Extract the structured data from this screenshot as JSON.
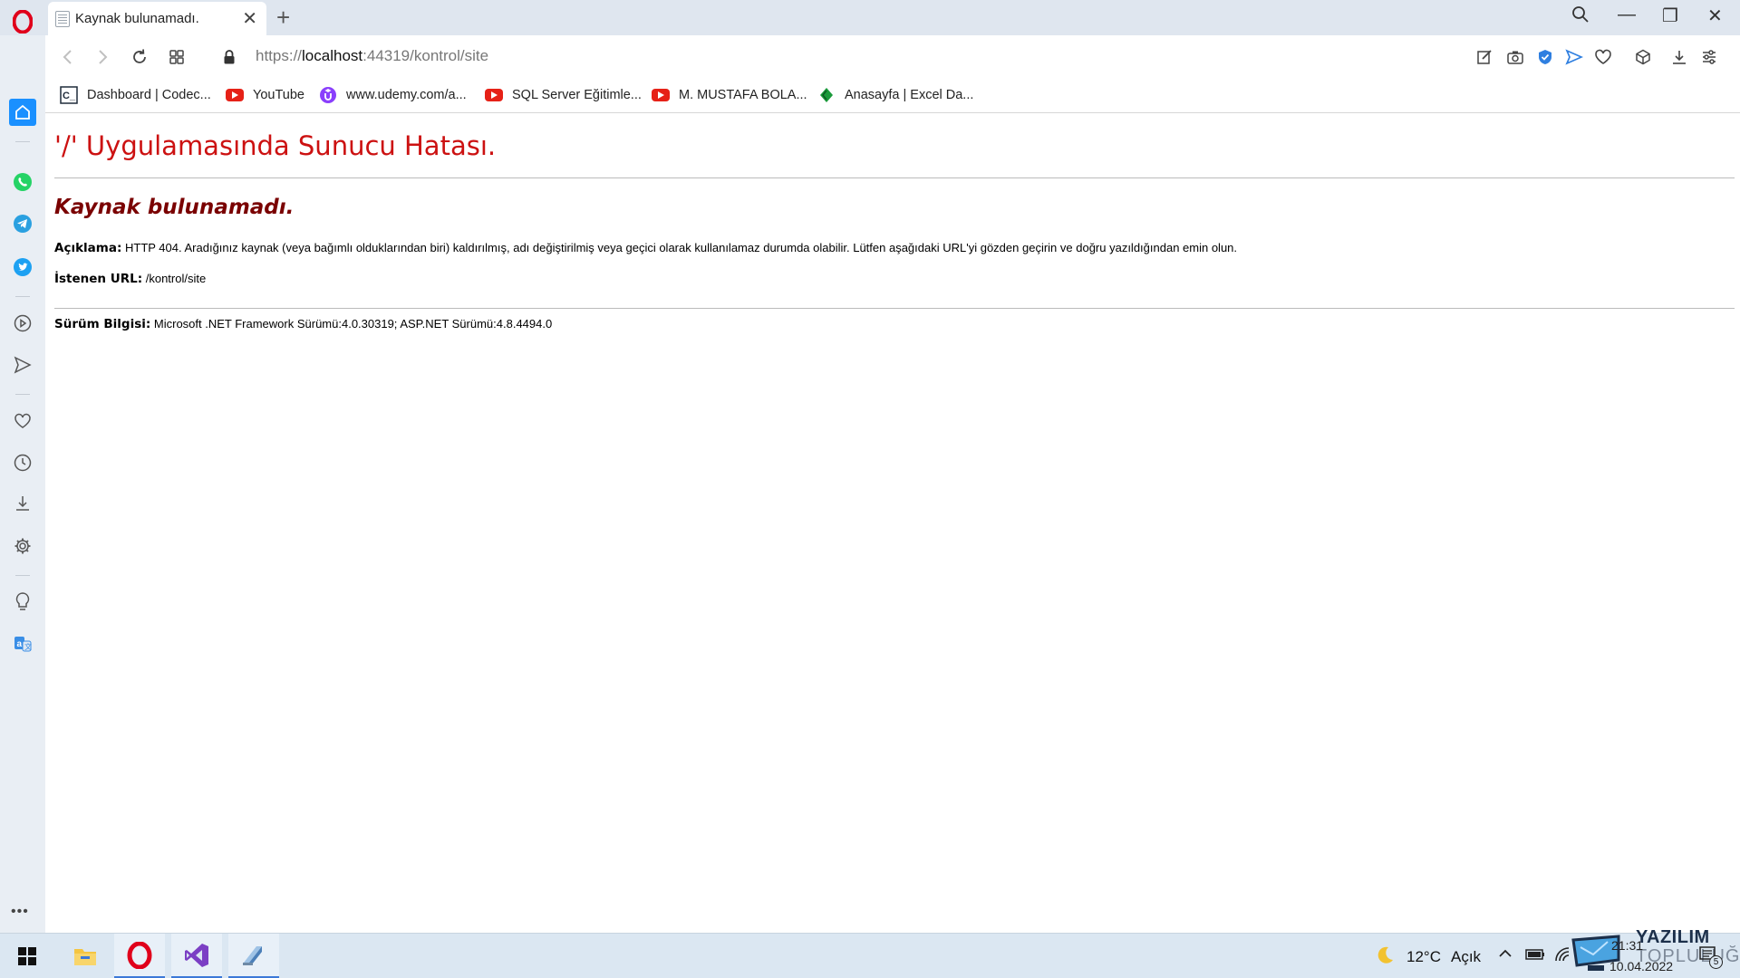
{
  "browser": {
    "tab": {
      "title": "Kaynak bulunamadı.",
      "close": "✕"
    },
    "new_tab": "+",
    "window": {
      "search": "search",
      "minimize": "—",
      "restore": "❐",
      "close": "✕"
    },
    "address": {
      "scheme": "https://",
      "host": "localhost",
      "rest": ":44319/kontrol/site"
    },
    "bookmarks": [
      {
        "label": "Dashboard | Codec..."
      },
      {
        "label": "YouTube"
      },
      {
        "label": "www.udemy.com/a..."
      },
      {
        "label": "SQL Server Eğitimle..."
      },
      {
        "label": "M. MUSTAFA BOLA..."
      },
      {
        "label": "Anasayfa | Excel Da..."
      }
    ],
    "sidebar_more": "•••"
  },
  "page": {
    "title": "'/' Uygulamasında Sunucu Hatası.",
    "subtitle": "Kaynak bulunamadı.",
    "description_label": "Açıklama:",
    "description_text": " HTTP 404. Aradığınız kaynak (veya bağımlı olduklarından biri) kaldırılmış, adı değiştirilmiş veya geçici olarak kullanılamaz durumda olabilir. Lütfen aşağıdaki URL'yi gözden geçirin ve doğru yazıldığından emin olun.",
    "url_label": "İstenen URL:",
    "url_value": " /kontrol/site",
    "version_label": "Sürüm Bilgisi:",
    "version_value": " Microsoft .NET Framework Sürümü:4.0.30319; ASP.NET Sürümü:4.8.4494.0"
  },
  "taskbar": {
    "weather": {
      "temp": "12°C",
      "condition": "Açık"
    },
    "clock": {
      "time": "21:31",
      "date": "10.04.2022"
    },
    "notification_count": "5",
    "watermark": {
      "line1": "YAZILIM",
      "line2": "TOPLULUĞU"
    }
  },
  "colors": {
    "error_title": "#cc1111",
    "error_subtitle": "#7a0000",
    "opera_red": "#e0001b",
    "sidebar_bg": "#e9eef4",
    "taskbar_bg": "#dbe7f2"
  }
}
